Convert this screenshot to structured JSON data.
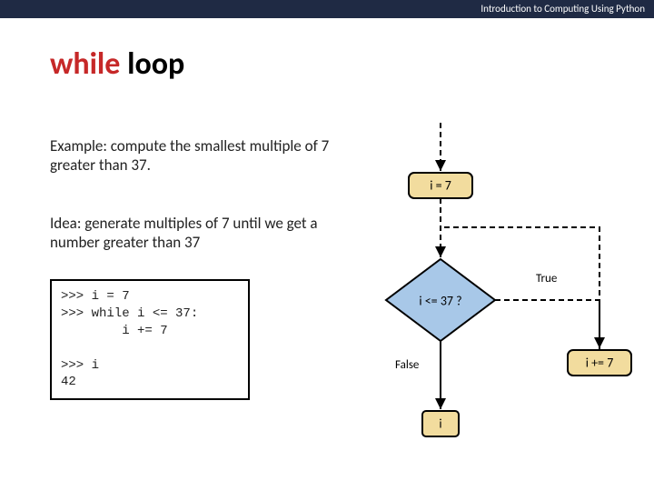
{
  "header": {
    "text": "Introduction to Computing Using Python"
  },
  "title": {
    "word1": "while",
    "word2": "loop"
  },
  "body": {
    "example": "Example: compute the smallest multiple of 7 greater than 37.",
    "idea": "Idea: generate multiples of 7 until we get a number greater than 37"
  },
  "code": {
    "text": ">>> i = 7\n>>> while i <= 37:\n        i += 7\n\n>>> i\n42"
  },
  "flow": {
    "init": "i = 7",
    "cond": "i <= 37 ?",
    "true_label": "True",
    "false_label": "False",
    "update": "i += 7",
    "output": "i"
  }
}
